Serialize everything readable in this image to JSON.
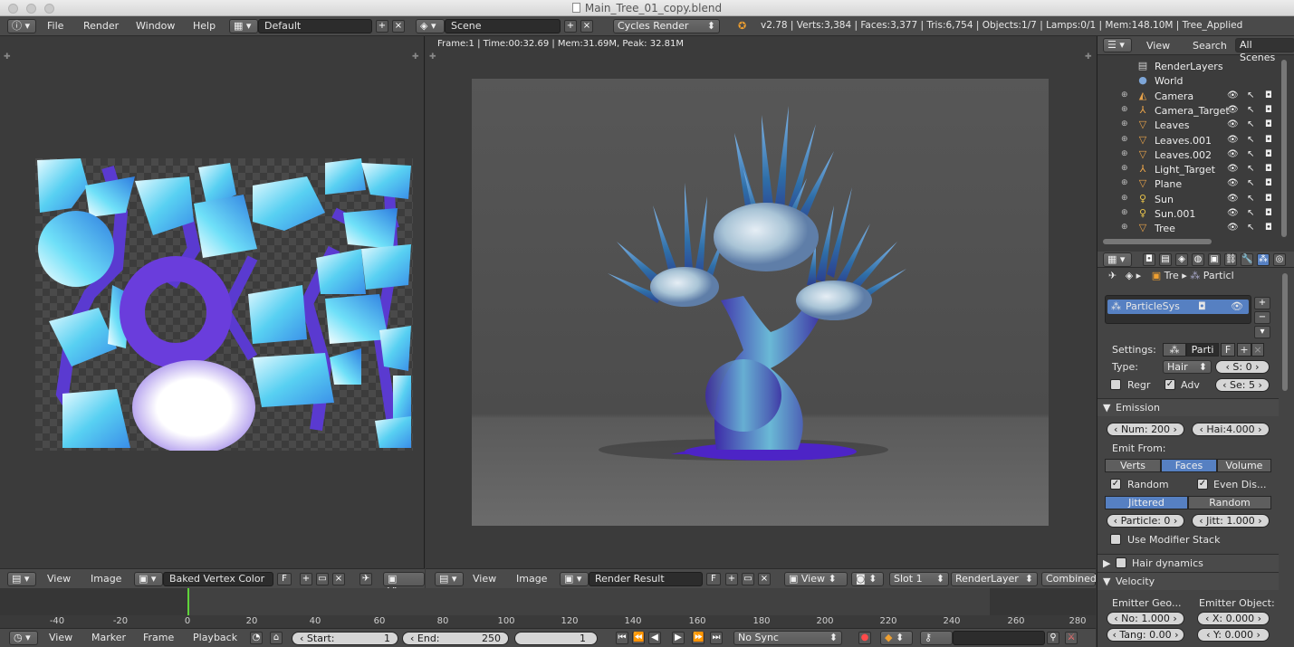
{
  "window": {
    "title": "Main_Tree_01_copy.blend"
  },
  "info_header": {
    "menus": [
      "File",
      "Render",
      "Window",
      "Help"
    ],
    "layout": "Default",
    "scene": "Scene",
    "engine": "Cycles Render",
    "stats": "v2.78 | Verts:3,384 | Faces:3,377 | Tris:6,754 | Objects:1/7 | Lamps:0/1 | Mem:148.10M | Tree_Applied"
  },
  "render_view": {
    "stats": "Frame:1 | Time:00:32.69 | Mem:31.69M, Peak: 32.81M"
  },
  "uv_header": {
    "view": "View",
    "image": "Image",
    "image_name": "Baked Vertex Color",
    "fake_user": "F",
    "view2": "Viev"
  },
  "image_header": {
    "view": "View",
    "image": "Image",
    "image_name": "Render Result",
    "fake_user": "F",
    "view_mode": "View",
    "slot": "Slot 1",
    "layer": "RenderLayer",
    "pass": "Combined"
  },
  "timeline": {
    "ticks": [
      "-40",
      "-20",
      "0",
      "20",
      "40",
      "60",
      "80",
      "100",
      "120",
      "140",
      "160",
      "180",
      "200",
      "220",
      "240",
      "260",
      "280"
    ],
    "menus": [
      "View",
      "Marker",
      "Frame",
      "Playback"
    ],
    "start_label": "Start:",
    "start_value": "1",
    "end_label": "End:",
    "end_value": "250",
    "current_frame": "1",
    "sync": "No Sync"
  },
  "outliner": {
    "view": "View",
    "search": "Search",
    "filter": "All Scenes",
    "items": [
      {
        "name": "RenderLayers",
        "icon": "render-layers-icon",
        "glyph": "▤",
        "color": "#cfcfcf"
      },
      {
        "name": "World",
        "icon": "world-icon",
        "glyph": "●",
        "color": "#7ea6d8"
      },
      {
        "name": "Camera",
        "icon": "camera-icon",
        "glyph": "◭",
        "color": "#e8a34a"
      },
      {
        "name": "Camera_Target",
        "icon": "empty-icon",
        "glyph": "⅄",
        "color": "#e8a34a"
      },
      {
        "name": "Leaves",
        "icon": "mesh-icon",
        "glyph": "▽",
        "color": "#e8a34a"
      },
      {
        "name": "Leaves.001",
        "icon": "mesh-icon",
        "glyph": "▽",
        "color": "#e8a34a"
      },
      {
        "name": "Leaves.002",
        "icon": "mesh-icon",
        "glyph": "▽",
        "color": "#e8a34a"
      },
      {
        "name": "Light_Target",
        "icon": "empty-icon",
        "glyph": "⅄",
        "color": "#e8a34a"
      },
      {
        "name": "Plane",
        "icon": "mesh-icon",
        "glyph": "▽",
        "color": "#e8a34a"
      },
      {
        "name": "Sun",
        "icon": "lamp-icon",
        "glyph": "♀",
        "color": "#e8c34a"
      },
      {
        "name": "Sun.001",
        "icon": "lamp-icon",
        "glyph": "♀",
        "color": "#e8c34a"
      },
      {
        "name": "Tree",
        "icon": "mesh-icon",
        "glyph": "▽",
        "color": "#e8a34a"
      }
    ]
  },
  "properties": {
    "breadcrumb_obj": "Tre",
    "breadcrumb_particles": "Particl",
    "particle_system": "ParticleSys",
    "settings_label": "Settings:",
    "settings_value": "Parti",
    "settings_fake": "F",
    "type_label": "Type:",
    "type_value": "Hair",
    "seed_label": "S:",
    "seed_value": "0",
    "regrow": "Regr",
    "advanced": "Adv",
    "segments_label": "Se:",
    "segments_value": "5",
    "emission": {
      "title": "Emission",
      "num_label": "Num:",
      "num_value": "200",
      "hair_len_label": "Hai:",
      "hair_len_value": "4.000",
      "emit_from": "Emit From:",
      "modes": [
        "Verts",
        "Faces",
        "Volume"
      ],
      "random": "Random",
      "even": "Even Dis...",
      "distribution": [
        "Jittered",
        "Random"
      ],
      "particle_label": "Particle:",
      "particle_value": "0",
      "jitter_label": "Jitt:",
      "jitter_value": "1.000",
      "modifier_stack": "Use Modifier Stack"
    },
    "hair_dynamics": "Hair dynamics",
    "velocity": {
      "title": "Velocity",
      "emitter_geo": "Emitter Geo...",
      "emitter_obj": "Emitter Object:",
      "normal_label": "No:",
      "normal_value": "1.000",
      "tangent_label": "Tang:",
      "tangent_value": "0.00",
      "x_label": "X:",
      "x_value": "0.000",
      "y_label": "Y:",
      "y_value": "0.000"
    }
  }
}
